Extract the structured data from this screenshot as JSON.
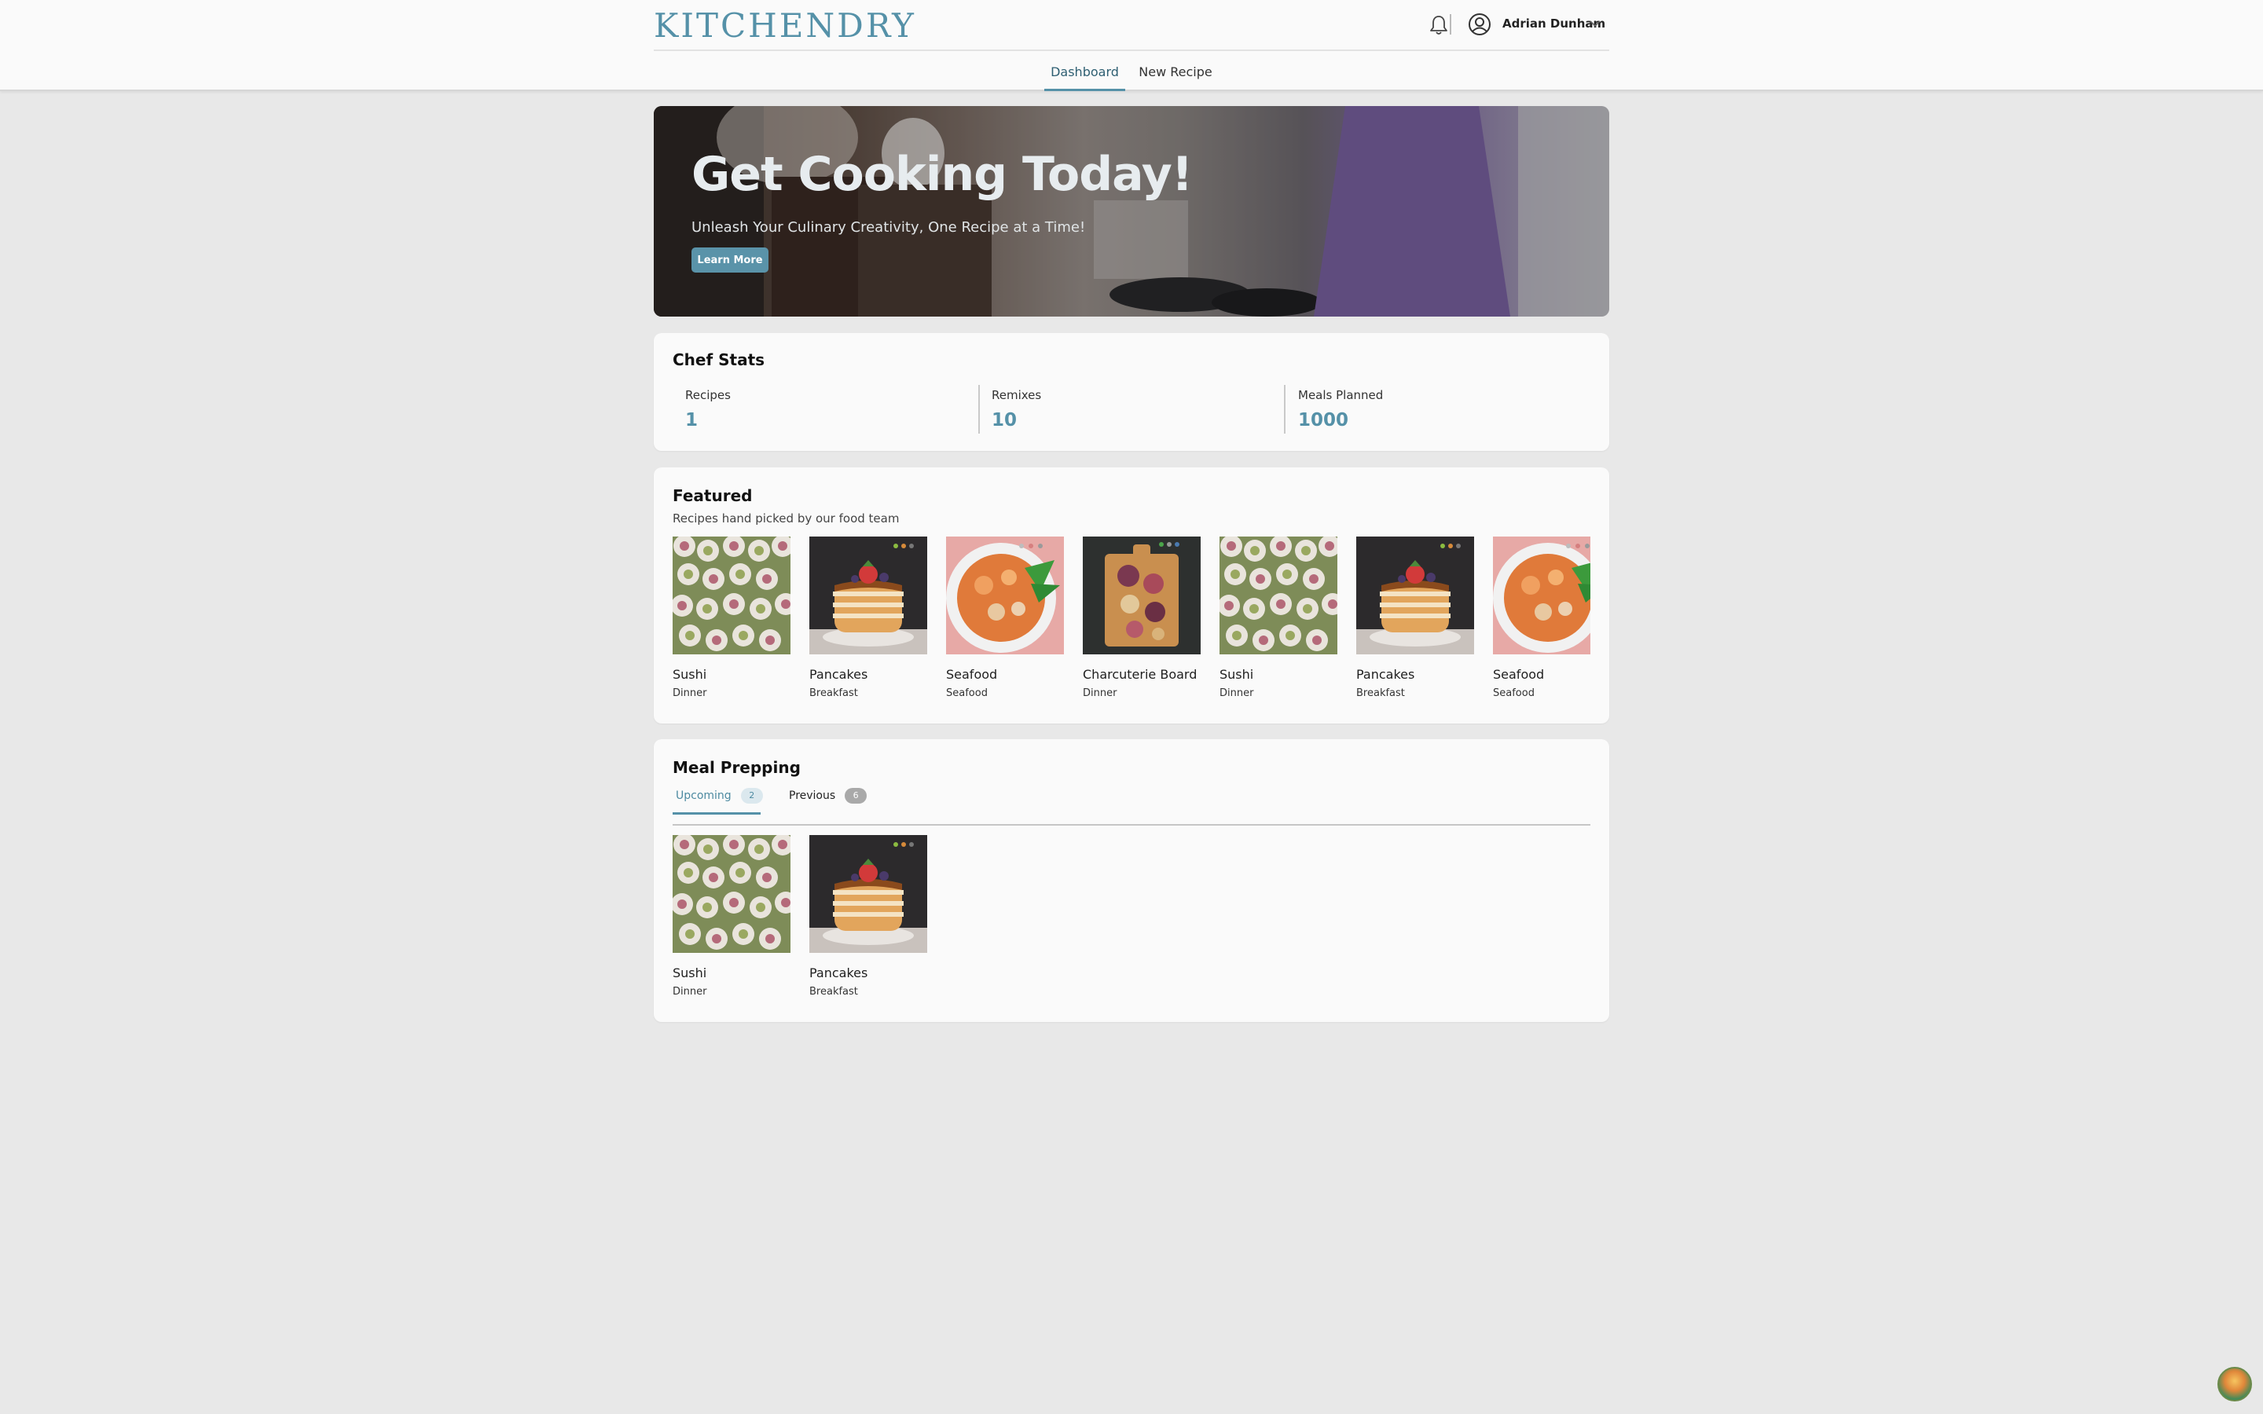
{
  "brand": {
    "logo": "KITCHENDRY",
    "accent": "#5591a8"
  },
  "header": {
    "user_name": "Adrian Dunham",
    "icons": [
      "bell-icon",
      "user-circle-icon",
      "chevron-down-icon"
    ],
    "nav": [
      {
        "label": "Dashboard",
        "active": true
      },
      {
        "label": "New Recipe",
        "active": false
      }
    ]
  },
  "hero": {
    "title": "Get Cooking Today!",
    "subtitle": "Unleash Your Culinary Creativity, One Recipe at a Time!",
    "button": "Learn More"
  },
  "stats": {
    "title": "Chef Stats",
    "items": [
      {
        "label": "Recipes",
        "value": "1"
      },
      {
        "label": "Remixes",
        "value": "10"
      },
      {
        "label": "Meals Planned",
        "value": "1000"
      }
    ]
  },
  "featured": {
    "title": "Featured",
    "subtitle": "Recipes hand picked by our food team",
    "recipes": [
      {
        "name": "Sushi",
        "category": "Dinner",
        "image": "sushi"
      },
      {
        "name": "Pancakes",
        "category": "Breakfast",
        "image": "pancakes"
      },
      {
        "name": "Seafood",
        "category": "Seafood",
        "image": "seafood"
      },
      {
        "name": "Charcuterie Board",
        "category": "Dinner",
        "image": "charcuterie"
      },
      {
        "name": "Sushi",
        "category": "Dinner",
        "image": "sushi"
      },
      {
        "name": "Pancakes",
        "category": "Breakfast",
        "image": "pancakes"
      },
      {
        "name": "Seafood",
        "category": "Seafood",
        "image": "seafood"
      }
    ]
  },
  "meal_prep": {
    "title": "Meal Prepping",
    "tabs": [
      {
        "label": "Upcoming",
        "count": "2",
        "active": true
      },
      {
        "label": "Previous",
        "count": "6",
        "active": false
      }
    ],
    "recipes": [
      {
        "name": "Sushi",
        "category": "Dinner",
        "image": "sushi"
      },
      {
        "name": "Pancakes",
        "category": "Breakfast",
        "image": "pancakes"
      }
    ]
  }
}
